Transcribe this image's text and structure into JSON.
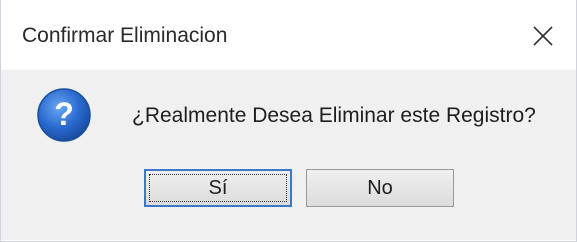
{
  "window": {
    "title": "Confirmar Eliminacion"
  },
  "dialog": {
    "message": "¿Realmente Desea Eliminar este Registro?",
    "icon": "question-icon",
    "buttons": {
      "yes_label": "Sí",
      "no_label": "No"
    }
  },
  "colors": {
    "icon_blue": "#2a6bd0",
    "focus_border": "#3b78c6",
    "body_background": "#f0f0f0"
  }
}
